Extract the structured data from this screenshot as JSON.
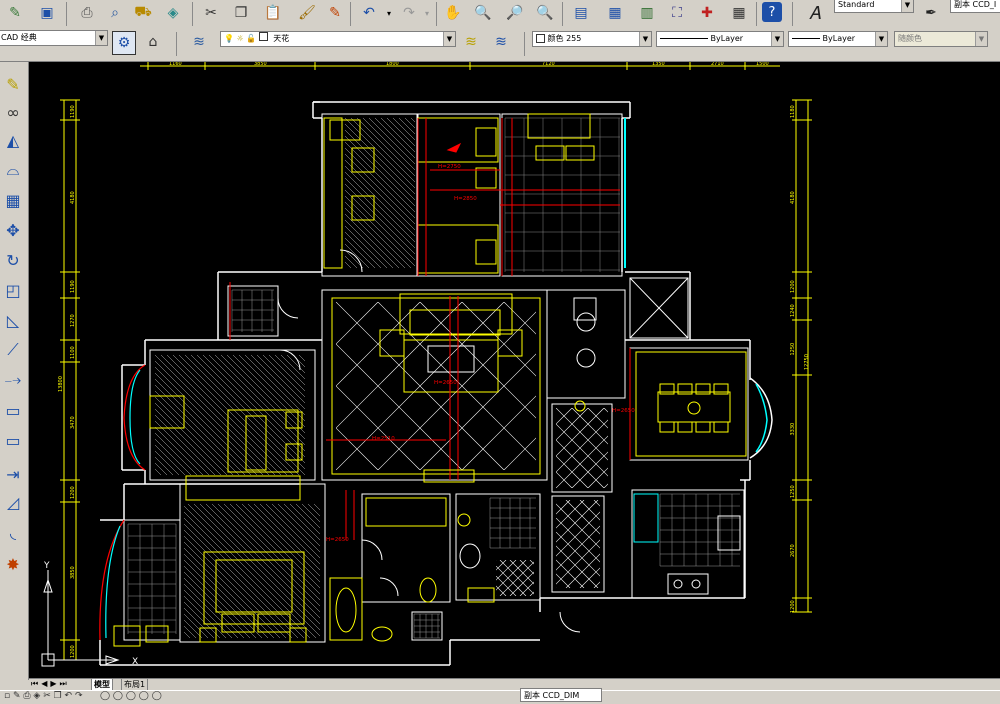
{
  "toolbar": {
    "text_style": "Standard",
    "dim_style": "副本 CCD_I"
  },
  "layers_bar": {
    "workspace": "CAD 经典",
    "layer": "天花",
    "color_label": "颜色 255",
    "linetype": "ByLayer",
    "lineweight": "ByLayer",
    "plotstyle": "随颜色"
  },
  "drawing": {
    "dims_top": [
      "1160",
      "3850",
      "1800",
      "7120",
      "1350",
      "2710",
      "1500"
    ],
    "dims_left": [
      "1190",
      "4180",
      "1190",
      "1270",
      "1100",
      "3470",
      "1200",
      "3850",
      "1200"
    ],
    "dims_left_total": "13800",
    "dims_right": [
      "1180",
      "4180",
      "1200",
      "1240",
      "1250",
      "3330",
      "1250",
      "2670",
      "1200"
    ],
    "dims_right_total": "12750",
    "level_labels": [
      "H=2750",
      "H=2850",
      "H=2650",
      "H=2510",
      "H=2650",
      "H=2650"
    ],
    "ucs_y": "Y",
    "ucs_x": "X"
  },
  "tabs": {
    "model": "模型",
    "layout1": "布局1"
  },
  "statusbar": {
    "dim_text": "副本 CCD_DIM"
  },
  "colors": {
    "wall": "#ffffff",
    "furniture": "#ffff00",
    "red_line": "#ff0000",
    "cyan": "#00ffff",
    "background": "#000000"
  }
}
